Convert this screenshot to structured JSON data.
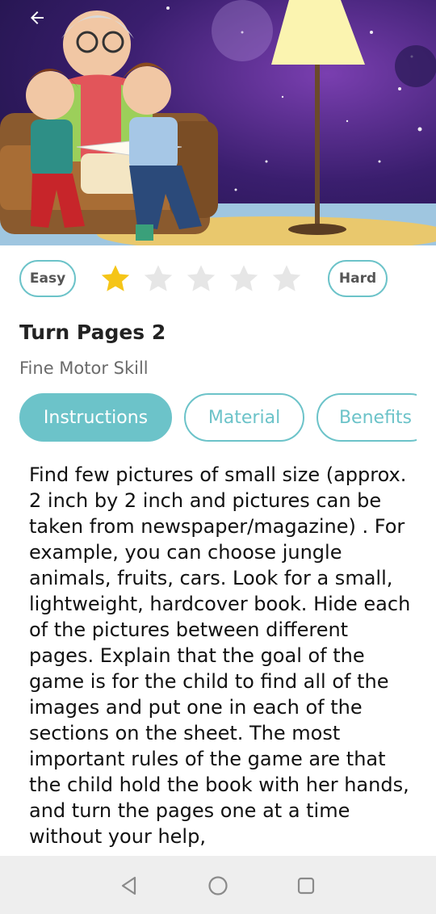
{
  "hero": {
    "image_description_icon": "grandmother-reading-to-children-illustration",
    "back_icon": "arrow-left-icon"
  },
  "difficulty": {
    "easy_label": "Easy",
    "hard_label": "Hard",
    "rating": 1,
    "max_rating": 5,
    "filled_color": "#f5c518",
    "empty_color": "#e6e6e6"
  },
  "activity": {
    "title": "Turn Pages 2",
    "category": "Fine Motor Skill"
  },
  "tabs": [
    {
      "label": "Instructions",
      "active": true
    },
    {
      "label": "Material",
      "active": false
    },
    {
      "label": "Benefits",
      "active": false
    }
  ],
  "content": {
    "text": "Find few pictures of small size (approx. 2 inch by 2 inch and pictures can be taken from newspaper/magazine) . For example, you can choose jungle animals, fruits, cars. Look for a small, lightweight, hardcover book. Hide each of the pictures between different pages. Explain that the goal of the game is for the child to find all of the images and put one in each of the sections on the sheet. The most important rules of the game are that the child hold the book with her hands, and turn the pages one at a time without your help,"
  },
  "theme": {
    "accent": "#6cc3c9"
  },
  "navbar": {
    "back_icon": "triangle-back-icon",
    "home_icon": "circle-home-icon",
    "recents_icon": "square-recents-icon"
  }
}
